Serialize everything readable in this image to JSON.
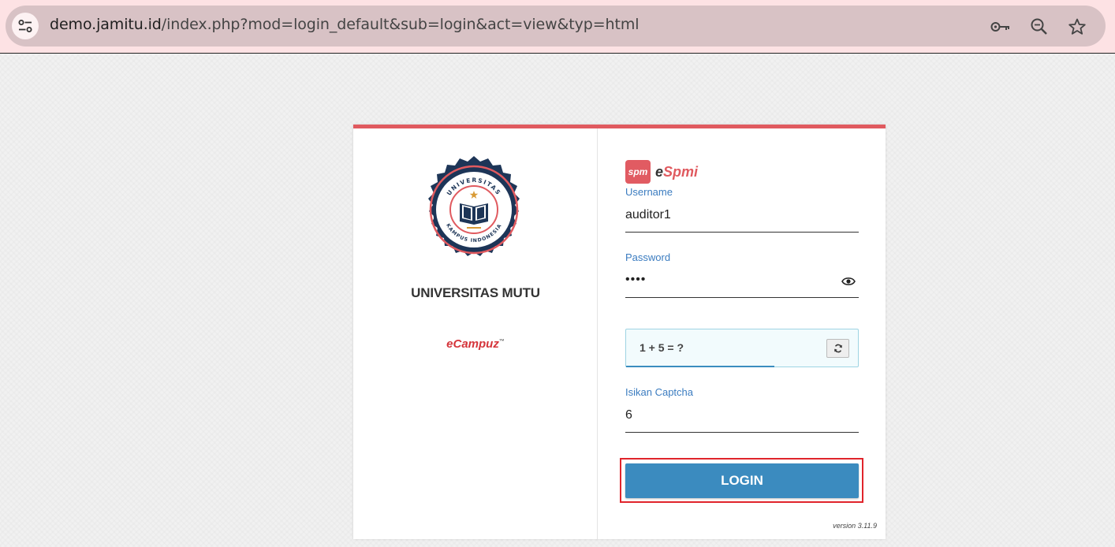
{
  "browser": {
    "url_host": "demo.jamitu.id",
    "url_path": "/index.php?mod=login_default&sub=login&act=view&typ=html",
    "icons": [
      "site-info-icon",
      "password-key-icon",
      "zoom-icon",
      "bookmark-star-icon"
    ]
  },
  "left": {
    "seal_top_text": "UNIVERSITAS",
    "seal_bottom_text": "KAMPUS INDONESIA",
    "university_name": "UNIVERSITAS MUTU",
    "vendor_logo": "eCampuz",
    "vendor_tm": "™"
  },
  "brand": {
    "badge": "spm",
    "name_prefix": "e",
    "name_rest": "Spmi"
  },
  "form": {
    "username_label": "Username",
    "username_value": "auditor1",
    "password_label": "Password",
    "password_masked": "••••",
    "captcha_question": "1 + 5 = ?",
    "captcha_label": "Isikan Captcha",
    "captcha_value": "6",
    "login_label": "LOGIN"
  },
  "footer": {
    "version": "version 3.11.9"
  },
  "colors": {
    "accent_red": "#e05a5f",
    "button_blue": "#3b8bbf",
    "label_blue": "#3b7cc0",
    "seal_navy": "#1d3557"
  }
}
